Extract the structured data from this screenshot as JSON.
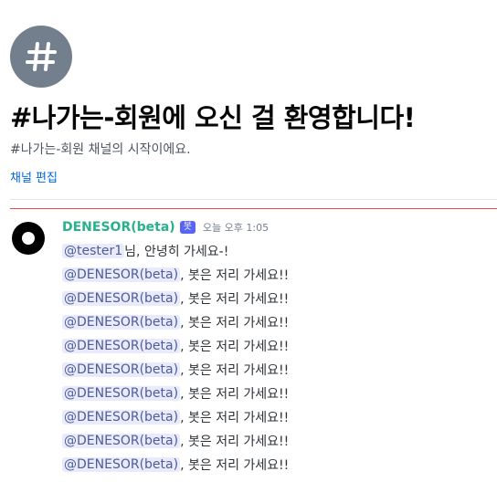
{
  "channel": {
    "icon": "hash-icon",
    "welcome_title": "#나가는-회원에 오신 걸 환영합니다!",
    "welcome_subtitle": "#나가는-회원 채널의 시작이에요.",
    "edit_label": "채널 편집"
  },
  "message": {
    "avatar": "avatar-icon",
    "username": "DENESOR(beta)",
    "bot_tag": "봇",
    "timestamp": "오늘 오후 1:05",
    "first_line": {
      "mention": "@tester1",
      "text": "님, 안녕히 가세요-!"
    },
    "repeat_lines": [
      {
        "mention": "@DENESOR(beta)",
        "text": ", 봇은 저리 가세요!!"
      },
      {
        "mention": "@DENESOR(beta)",
        "text": ", 봇은 저리 가세요!!"
      },
      {
        "mention": "@DENESOR(beta)",
        "text": ", 봇은 저리 가세요!!"
      },
      {
        "mention": "@DENESOR(beta)",
        "text": ", 봇은 저리 가세요!!"
      },
      {
        "mention": "@DENESOR(beta)",
        "text": ", 봇은 저리 가세요!!"
      },
      {
        "mention": "@DENESOR(beta)",
        "text": ", 봇은 저리 가세요!!"
      },
      {
        "mention": "@DENESOR(beta)",
        "text": ", 봇은 저리 가세요!!"
      },
      {
        "mention": "@DENESOR(beta)",
        "text": ", 봇은 저리 가세요!!"
      },
      {
        "mention": "@DENESOR(beta)",
        "text": ", 봇은 저리 가세요!!"
      }
    ]
  },
  "colors": {
    "username": "#2ab08a",
    "bot_tag": "#5865f2",
    "mention_bg": "#e9ebfd",
    "mention_text": "#4e5d94",
    "new_divider": "#f04747",
    "link": "#0068e0"
  }
}
